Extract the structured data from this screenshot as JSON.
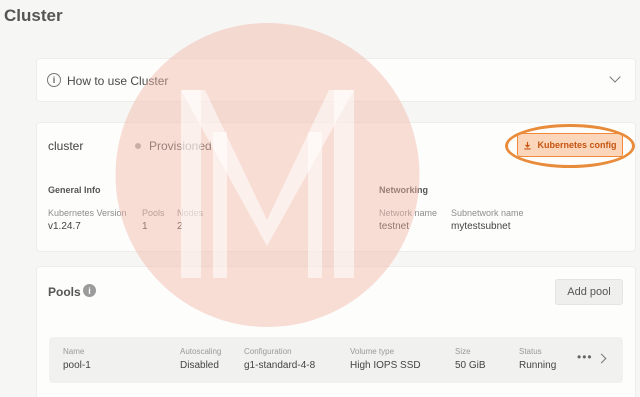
{
  "page": {
    "title": "Cluster"
  },
  "howto": {
    "label": "How to use Cluster",
    "info_glyph": "i"
  },
  "cluster": {
    "name": "cluster",
    "status": "Provisioned",
    "kube_config_label": "Kubernetes config",
    "general_info": {
      "heading": "General Info",
      "fields": [
        {
          "label": "Kubernetes Version",
          "value": "v1.24.7"
        },
        {
          "label": "Pools",
          "value": "1"
        },
        {
          "label": "Nodes",
          "value": "2"
        }
      ]
    },
    "networking": {
      "heading": "Networking",
      "fields": [
        {
          "label": "Network name",
          "value": "testnet"
        },
        {
          "label": "Subnetwork name",
          "value": "mytestsubnet"
        }
      ]
    }
  },
  "pools": {
    "title": "Pools",
    "info_glyph": "i",
    "add_label": "Add pool",
    "more_glyph": "•••",
    "columns": [
      "Name",
      "Autoscaling",
      "Configuration",
      "Volume type",
      "Size",
      "Status"
    ],
    "rows": [
      {
        "cells": [
          "pool-1",
          "Disabled",
          "g1-standard-4-8",
          "High IOPS SSD",
          "50 GiB",
          "Running"
        ]
      }
    ]
  },
  "colors": {
    "accent": "#f08a3a",
    "accent_bg": "#fbd6bb",
    "accent_text": "#c65410",
    "watermark": "#f2b6a6"
  },
  "icons": [
    "info-icon",
    "chevron-down-icon",
    "download-icon",
    "more-icon",
    "chevron-right-icon"
  ]
}
